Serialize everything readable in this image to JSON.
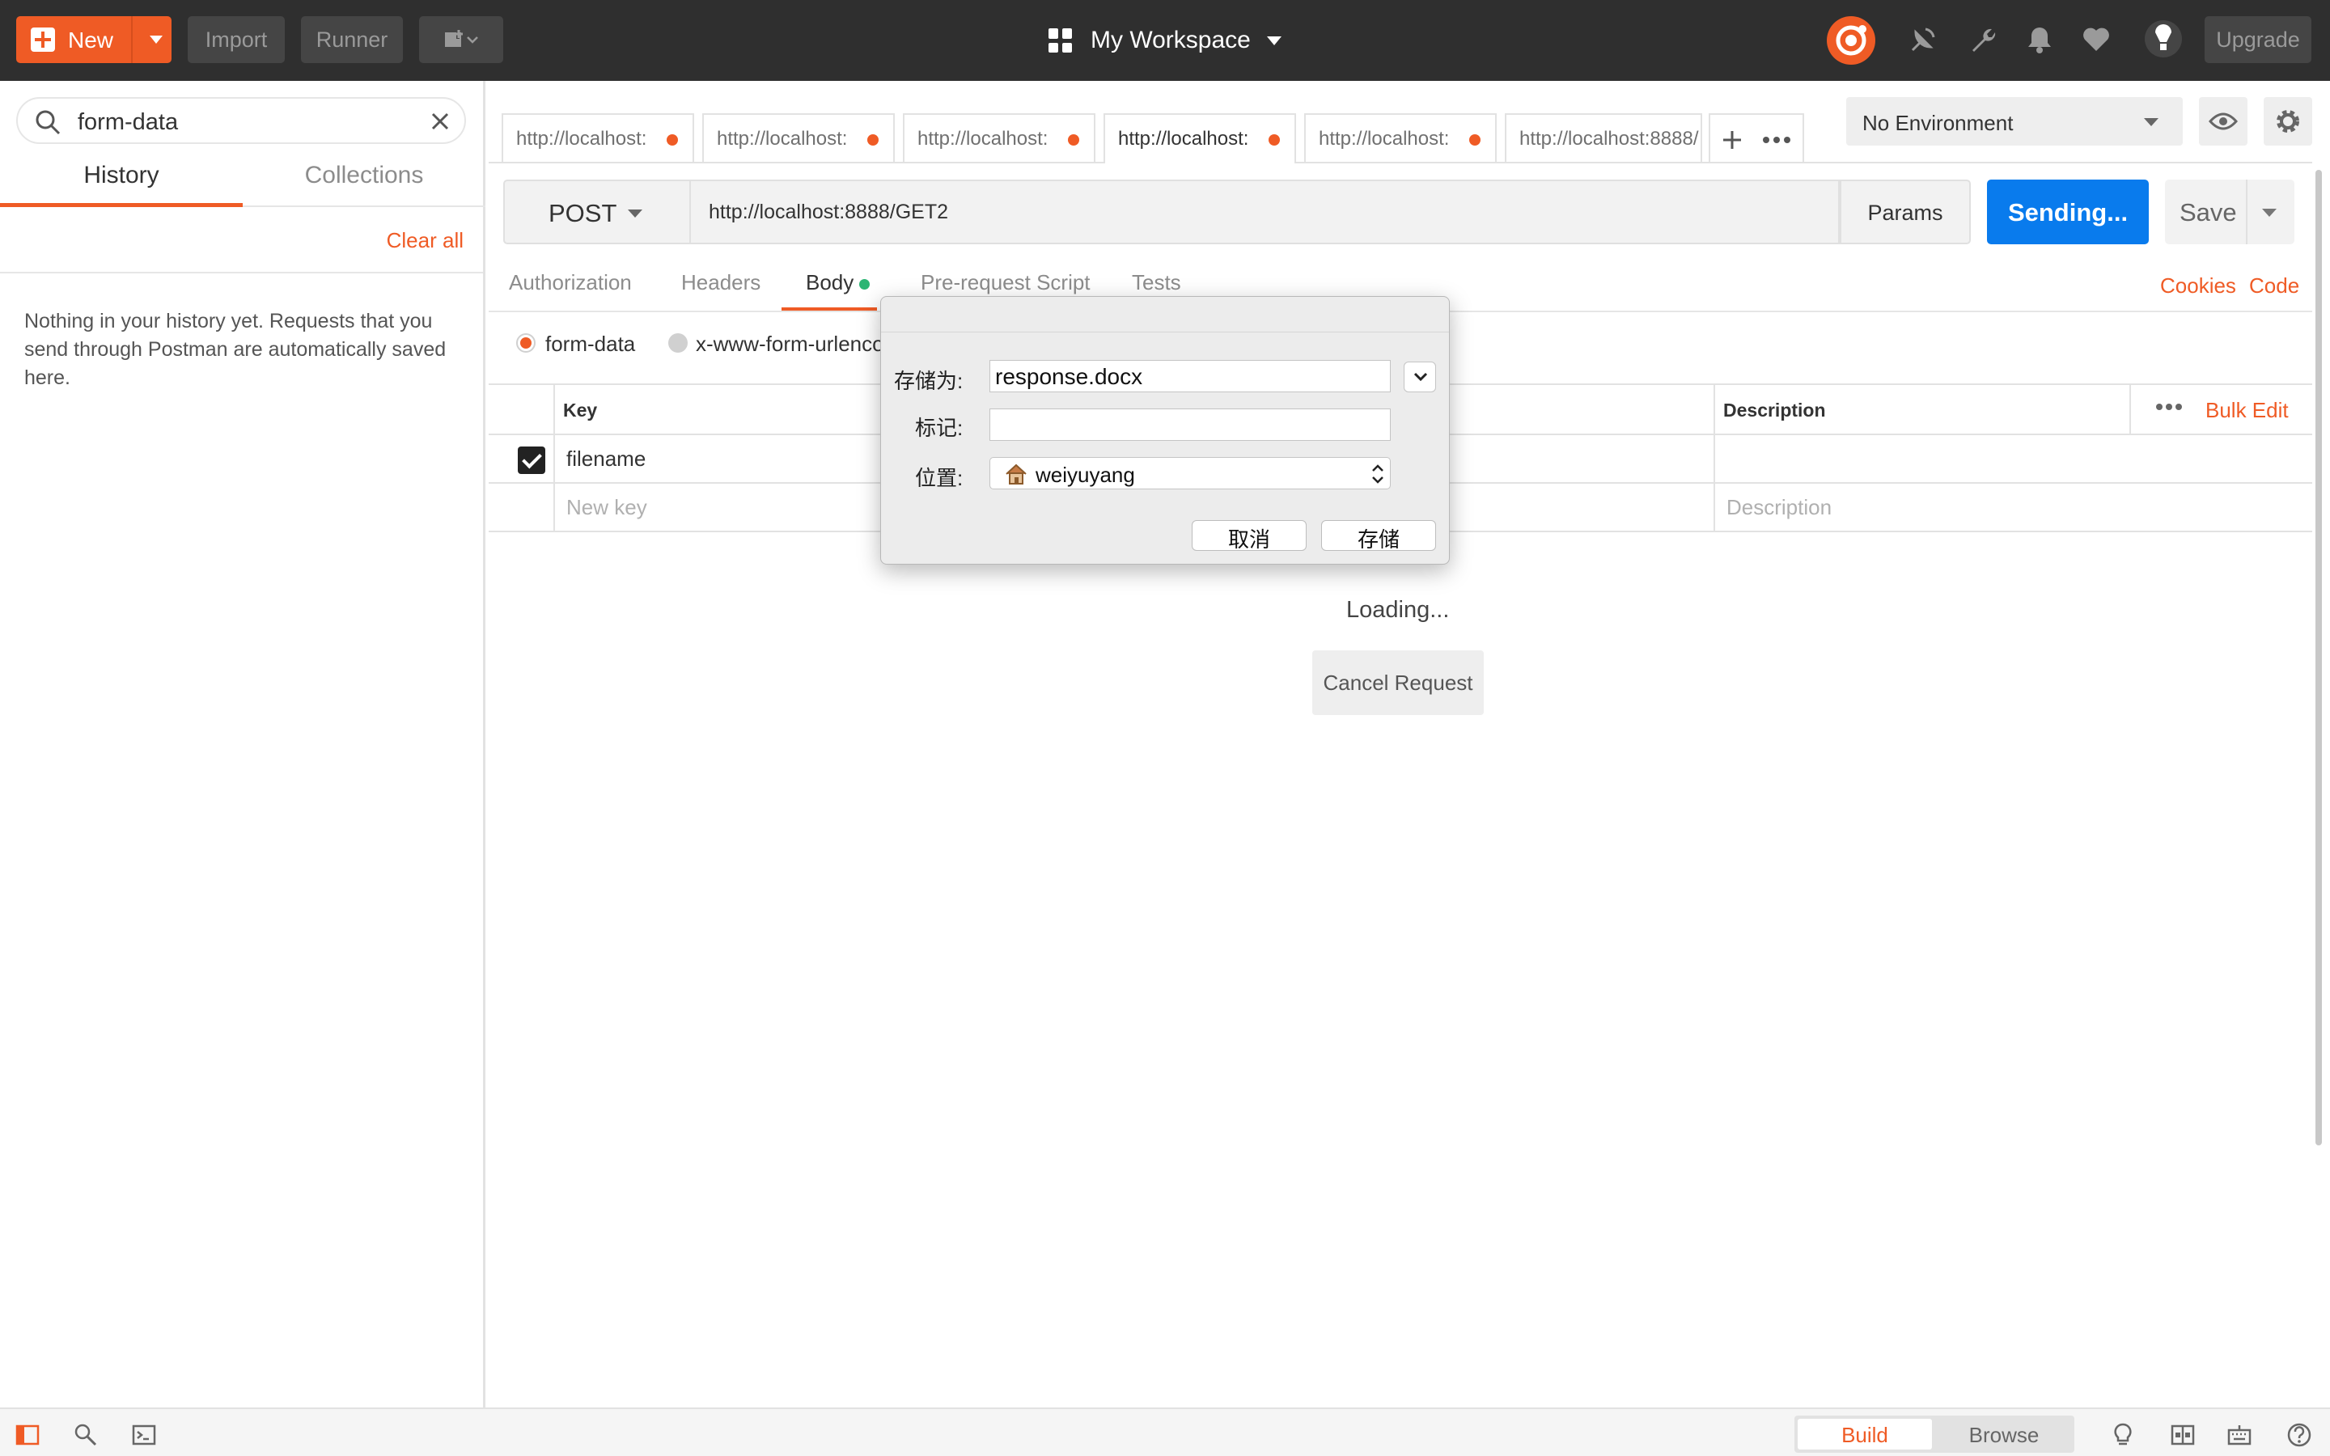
{
  "topbar": {
    "new_label": "New",
    "import_label": "Import",
    "runner_label": "Runner",
    "workspace_label": "My Workspace",
    "upgrade_label": "Upgrade",
    "accent_color": "#ef5b25"
  },
  "sidebar": {
    "search_value": "form-data",
    "tabs": [
      "History",
      "Collections"
    ],
    "clear_all": "Clear all",
    "empty_message": "Nothing in your history yet. Requests that you send through Postman are automatically saved here."
  },
  "request_tabs": [
    {
      "label": "http://localhost:"
    },
    {
      "label": "http://localhost:"
    },
    {
      "label": "http://localhost:"
    },
    {
      "label": "http://localhost:"
    },
    {
      "label": "http://localhost:"
    },
    {
      "label": "http://localhost:8888/"
    }
  ],
  "environment": {
    "selected": "No Environment"
  },
  "request": {
    "method": "POST",
    "url": "http://localhost:8888/GET2",
    "params_label": "Params",
    "send_label": "Sending...",
    "save_label": "Save",
    "send_color": "#097bed"
  },
  "subtabs": {
    "items": [
      "Authorization",
      "Headers",
      "Body",
      "Pre-request Script",
      "Tests"
    ],
    "cookies": "Cookies",
    "code": "Code"
  },
  "body": {
    "modes": [
      "form-data",
      "x-www-form-urlenco"
    ],
    "table": {
      "col_key": "Key",
      "col_description": "Description",
      "bulk_edit": "Bulk Edit",
      "rows": [
        {
          "key": "filename",
          "checked": true
        }
      ],
      "new_key_placeholder": "New key",
      "description_placeholder": "Description"
    }
  },
  "response": {
    "loading": "Loading...",
    "cancel_label": "Cancel Request"
  },
  "save_dialog": {
    "save_as_label": "存储为:",
    "save_as_value": "response.docx",
    "tags_label": "标记:",
    "tags_value": "",
    "location_label": "位置:",
    "location_value": "weiyuyang",
    "cancel_label": "取消",
    "save_label": "存储"
  },
  "statusbar": {
    "build_label": "Build",
    "browse_label": "Browse"
  }
}
